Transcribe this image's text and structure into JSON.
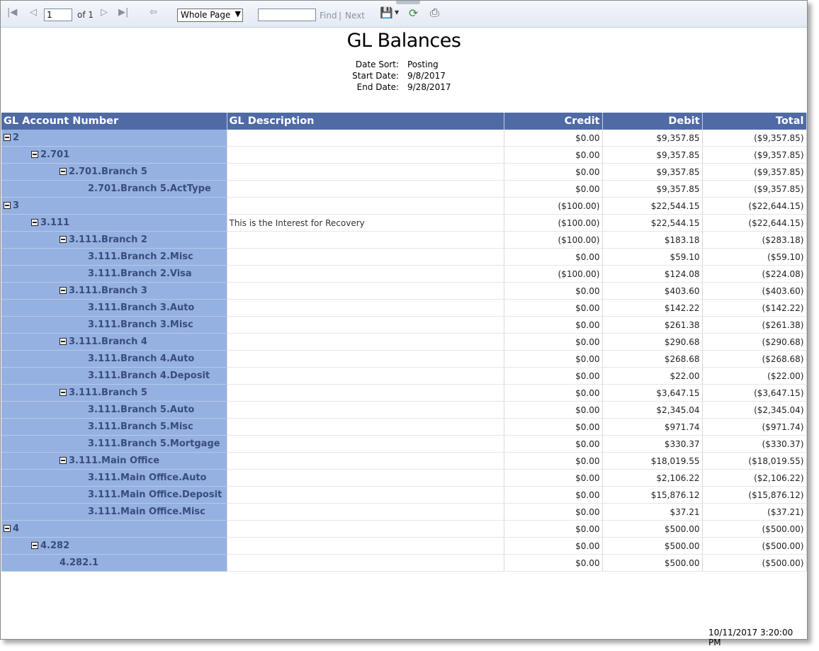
{
  "toolbar": {
    "page_value": "1",
    "page_of": "of 1",
    "zoom_selected": "Whole Page",
    "find_label": "Find",
    "separator": "|",
    "next_label": "Next"
  },
  "report": {
    "title": "GL Balances",
    "meta": [
      {
        "label": "Date Sort:",
        "value": "Posting"
      },
      {
        "label": "Start Date:",
        "value": "9/8/2017"
      },
      {
        "label": "End Date:",
        "value": "9/28/2017"
      }
    ],
    "columns": {
      "account": "GL Account Number",
      "description": "GL Description",
      "credit": "Credit",
      "debit": "Debit",
      "total": "Total"
    },
    "rows": [
      {
        "level": 0,
        "collapsible": true,
        "account": "2",
        "description": "",
        "credit": "$0.00",
        "debit": "$9,357.85",
        "total": "($9,357.85)"
      },
      {
        "level": 1,
        "collapsible": true,
        "account": "2.701",
        "description": "",
        "credit": "$0.00",
        "debit": "$9,357.85",
        "total": "($9,357.85)"
      },
      {
        "level": 2,
        "collapsible": true,
        "account": "2.701.Branch 5",
        "description": "",
        "credit": "$0.00",
        "debit": "$9,357.85",
        "total": "($9,357.85)"
      },
      {
        "level": 3,
        "collapsible": false,
        "account": "2.701.Branch 5.ActType",
        "description": "",
        "credit": "$0.00",
        "debit": "$9,357.85",
        "total": "($9,357.85)"
      },
      {
        "level": 0,
        "collapsible": true,
        "account": "3",
        "description": "",
        "credit": "($100.00)",
        "debit": "$22,544.15",
        "total": "($22,644.15)"
      },
      {
        "level": 1,
        "collapsible": true,
        "account": "3.111",
        "description": "This is the Interest for Recovery",
        "credit": "($100.00)",
        "debit": "$22,544.15",
        "total": "($22,644.15)"
      },
      {
        "level": 2,
        "collapsible": true,
        "account": "3.111.Branch 2",
        "description": "",
        "credit": "($100.00)",
        "debit": "$183.18",
        "total": "($283.18)"
      },
      {
        "level": 3,
        "collapsible": false,
        "account": "3.111.Branch 2.Misc",
        "description": "",
        "credit": "$0.00",
        "debit": "$59.10",
        "total": "($59.10)"
      },
      {
        "level": 3,
        "collapsible": false,
        "account": "3.111.Branch 2.Visa",
        "description": "",
        "credit": "($100.00)",
        "debit": "$124.08",
        "total": "($224.08)"
      },
      {
        "level": 2,
        "collapsible": true,
        "account": "3.111.Branch 3",
        "description": "",
        "credit": "$0.00",
        "debit": "$403.60",
        "total": "($403.60)"
      },
      {
        "level": 3,
        "collapsible": false,
        "account": "3.111.Branch 3.Auto",
        "description": "",
        "credit": "$0.00",
        "debit": "$142.22",
        "total": "($142.22)"
      },
      {
        "level": 3,
        "collapsible": false,
        "account": "3.111.Branch 3.Misc",
        "description": "",
        "credit": "$0.00",
        "debit": "$261.38",
        "total": "($261.38)"
      },
      {
        "level": 2,
        "collapsible": true,
        "account": "3.111.Branch 4",
        "description": "",
        "credit": "$0.00",
        "debit": "$290.68",
        "total": "($290.68)"
      },
      {
        "level": 3,
        "collapsible": false,
        "account": "3.111.Branch 4.Auto",
        "description": "",
        "credit": "$0.00",
        "debit": "$268.68",
        "total": "($268.68)"
      },
      {
        "level": 3,
        "collapsible": false,
        "account": "3.111.Branch 4.Deposit",
        "description": "",
        "credit": "$0.00",
        "debit": "$22.00",
        "total": "($22.00)"
      },
      {
        "level": 2,
        "collapsible": true,
        "account": "3.111.Branch 5",
        "description": "",
        "credit": "$0.00",
        "debit": "$3,647.15",
        "total": "($3,647.15)"
      },
      {
        "level": 3,
        "collapsible": false,
        "account": "3.111.Branch 5.Auto",
        "description": "",
        "credit": "$0.00",
        "debit": "$2,345.04",
        "total": "($2,345.04)"
      },
      {
        "level": 3,
        "collapsible": false,
        "account": "3.111.Branch 5.Misc",
        "description": "",
        "credit": "$0.00",
        "debit": "$971.74",
        "total": "($971.74)"
      },
      {
        "level": 3,
        "collapsible": false,
        "account": "3.111.Branch 5.Mortgage",
        "description": "",
        "credit": "$0.00",
        "debit": "$330.37",
        "total": "($330.37)"
      },
      {
        "level": 2,
        "collapsible": true,
        "account": "3.111.Main Office",
        "description": "",
        "credit": "$0.00",
        "debit": "$18,019.55",
        "total": "($18,019.55)"
      },
      {
        "level": 3,
        "collapsible": false,
        "account": "3.111.Main Office.Auto",
        "description": "",
        "credit": "$0.00",
        "debit": "$2,106.22",
        "total": "($2,106.22)"
      },
      {
        "level": 3,
        "collapsible": false,
        "account": "3.111.Main Office.Deposit",
        "description": "",
        "credit": "$0.00",
        "debit": "$15,876.12",
        "total": "($15,876.12)"
      },
      {
        "level": 3,
        "collapsible": false,
        "account": "3.111.Main Office.Misc",
        "description": "",
        "credit": "$0.00",
        "debit": "$37.21",
        "total": "($37.21)"
      },
      {
        "level": 0,
        "collapsible": true,
        "account": "4",
        "description": "",
        "credit": "$0.00",
        "debit": "$500.00",
        "total": "($500.00)"
      },
      {
        "level": 1,
        "collapsible": true,
        "account": "4.282",
        "description": "",
        "credit": "$0.00",
        "debit": "$500.00",
        "total": "($500.00)"
      },
      {
        "level": 2,
        "collapsible": false,
        "account": "4.282.1",
        "description": "",
        "credit": "$0.00",
        "debit": "$500.00",
        "total": "($500.00)"
      }
    ],
    "footer_timestamp": "10/11/2017 3:20:00 PM"
  },
  "colors": {
    "header_bg": "#4f6aa5",
    "account_cell_bg": "#95b1e1",
    "account_text": "#3a4c7a"
  },
  "icons": [
    "first-page-icon",
    "prev-page-icon",
    "next-page-icon",
    "last-page-icon",
    "back-icon",
    "export-save-icon",
    "refresh-icon",
    "print-icon",
    "collapse-icon"
  ]
}
